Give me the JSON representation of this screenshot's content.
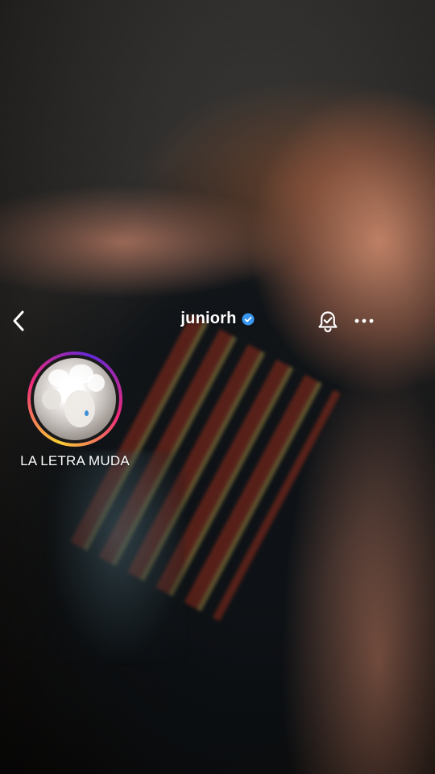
{
  "header": {
    "username": "juniorh",
    "verified": true,
    "back_icon": "chevron-left-icon",
    "bell_icon": "bell-icon",
    "more_icon": "more-horizontal-icon"
  },
  "highlight": {
    "label": "LA LETRA MUDA",
    "cover_icon": "statue-photo-icon"
  },
  "colors": {
    "verified_badge": "#3897f0",
    "ring_gradient": [
      "#f9ce34",
      "#ee2a7b",
      "#6228d7"
    ],
    "text": "#ffffff"
  }
}
